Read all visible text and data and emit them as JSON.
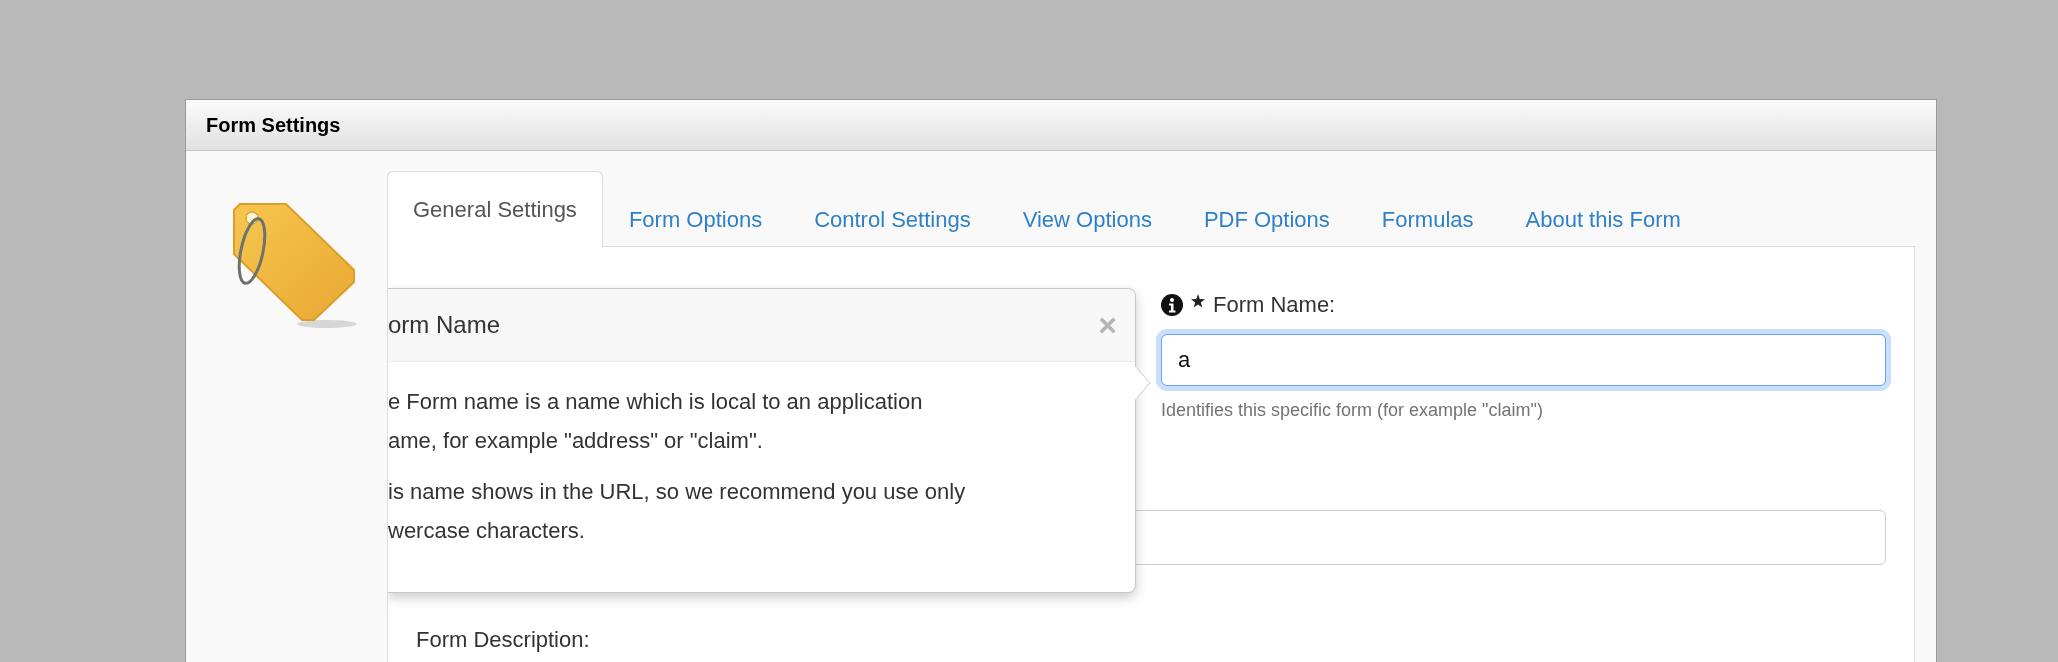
{
  "window": {
    "title": "Form Settings"
  },
  "tabs": [
    {
      "label": "General Settings",
      "selected": true
    },
    {
      "label": "Form Options",
      "selected": false
    },
    {
      "label": "Control Settings",
      "selected": false
    },
    {
      "label": "View Options",
      "selected": false
    },
    {
      "label": "PDF Options",
      "selected": false
    },
    {
      "label": "Formulas",
      "selected": false
    },
    {
      "label": "About this Form",
      "selected": false
    }
  ],
  "popover": {
    "title": "orm Name",
    "close": "×",
    "paragraphs": [
      {
        "lines": [
          "e Form name is a name which is local to an application",
          "ame, for example \"address\" or \"claim\"."
        ]
      },
      {
        "lines": [
          "is name shows in the URL, so we recommend you use only",
          "wercase characters."
        ]
      }
    ]
  },
  "form_name": {
    "label": "Form Name:",
    "required": true,
    "value": "a",
    "focused": true,
    "hint": "Identifies this specific form (for example \"claim\")"
  },
  "description_label": "Form Description:"
}
